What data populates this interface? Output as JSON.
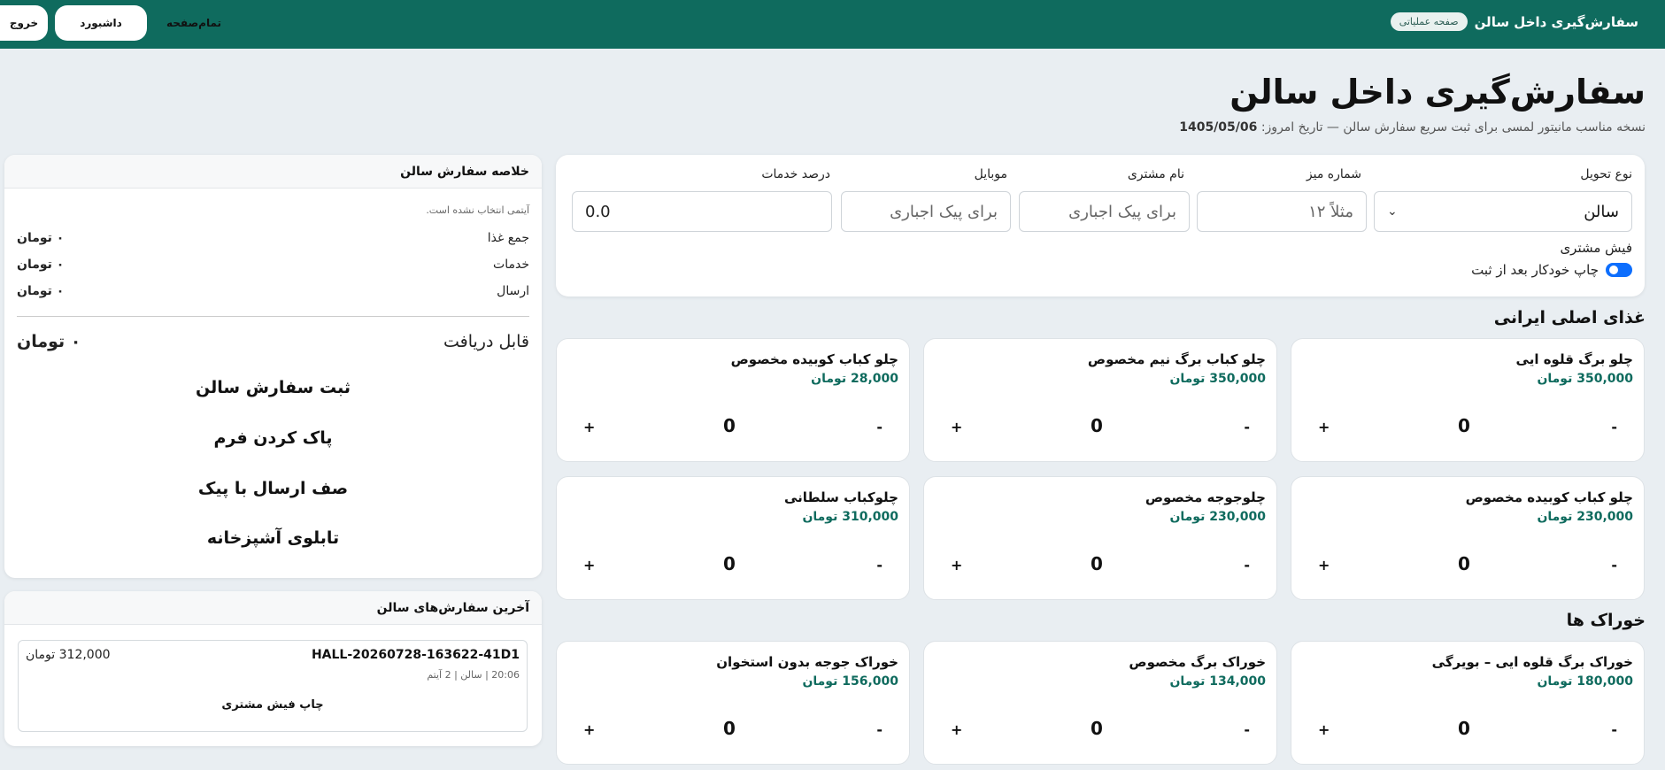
{
  "topbar": {
    "badge": "صفحه عملیاتی",
    "title": "سفارش‌گیری داخل سالن",
    "logout": "خروج",
    "dashboard": "داشبورد",
    "fullscreen": "تمام‌صفحه"
  },
  "page": {
    "title": "سفارش‌گیری داخل سالن",
    "subtitle": "نسخه مناسب مانیتور لمسی برای ثبت سریع سفارش سالن — تاریخ امروز:",
    "date": "1405/05/06"
  },
  "form": {
    "delivery_type": {
      "label": "نوع تحویل",
      "value": "سالن"
    },
    "table_no": {
      "label": "شماره میز",
      "placeholder": "مثلاً ۱۲"
    },
    "customer_name": {
      "label": "نام مشتری",
      "placeholder": "برای پیک اجباری"
    },
    "mobile": {
      "label": "موبایل",
      "placeholder": "برای پیک اجباری"
    },
    "service_percent": {
      "label": "درصد خدمات",
      "value": "0.0"
    },
    "receipt_label": "فیش مشتری",
    "auto_print_label": "چاپ خودکار بعد از ثبت",
    "auto_print_on": true
  },
  "sections": [
    {
      "title": "غذای اصلی ایرانی",
      "items": [
        {
          "name": "چلو برگ قلوه ایی",
          "price": "350,000 تومان",
          "qty": "0"
        },
        {
          "name": "چلو کباب برگ نیم مخصوص",
          "price": "350,000 تومان",
          "qty": "0"
        },
        {
          "name": "چلو کباب کوبیده مخصوص",
          "price": "28,000 تومان",
          "qty": "0"
        },
        {
          "name": "چلو کباب کوبیده مخصوص",
          "price": "230,000 تومان",
          "qty": "0"
        },
        {
          "name": "چلوجوجه مخصوص",
          "price": "230,000 تومان",
          "qty": "0"
        },
        {
          "name": "چلوکباب سلطانی",
          "price": "310,000 تومان",
          "qty": "0"
        }
      ]
    },
    {
      "title": "خوراک ها",
      "items": [
        {
          "name": "خوراک برگ قلوه ایی – بویرگی",
          "price": "180,000 تومان",
          "qty": "0"
        },
        {
          "name": "خوراک برگ مخصوص",
          "price": "134,000 تومان",
          "qty": "0"
        },
        {
          "name": "خوراک جوجه بدون استخوان",
          "price": "156,000 تومان",
          "qty": "0"
        }
      ]
    }
  ],
  "qty_controls": {
    "minus": "-",
    "plus": "+"
  },
  "summary": {
    "title": "خلاصه سفارش سالن",
    "empty_note": "آیتمی انتخاب نشده است.",
    "rows": [
      {
        "label": "جمع غذا",
        "amount": "۰ تومان"
      },
      {
        "label": "خدمات",
        "amount": "۰ تومان"
      },
      {
        "label": "ارسال",
        "amount": "۰ تومان"
      }
    ],
    "payable_label": "قابل دریافت",
    "payable_amount": "۰ تومان",
    "actions": [
      "ثبت سفارش سالن",
      "پاک کردن فرم",
      "صف ارسال با پیک",
      "تابلوی آشپزخانه"
    ]
  },
  "recent": {
    "title": "آخرین سفارش‌های سالن",
    "orders": [
      {
        "code": "HALL-20260728-163622-41D1",
        "total": "312,000 تومان",
        "meta": "20:06 | سالن | 2 آیتم",
        "print": "چاپ فیش مشتری"
      }
    ]
  },
  "colors": {
    "topbar": "#0f6b5e",
    "price": "#0f6b5e",
    "toggle": "#0d6efd",
    "background": "#e9eef2"
  }
}
